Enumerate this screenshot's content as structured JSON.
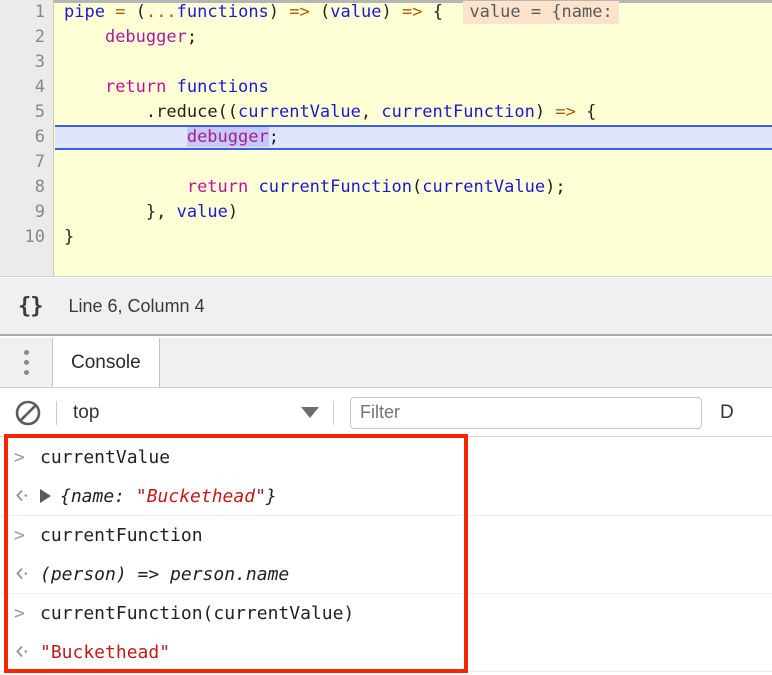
{
  "editor": {
    "language_icon": "curly-braces-icon",
    "line_numbers": [
      1,
      2,
      3,
      4,
      5,
      6,
      7,
      8,
      9,
      10
    ],
    "active_line": 6,
    "inline_hint": "value = {name:",
    "lines": [
      {
        "n": 1,
        "tokens": [
          {
            "t": "pipe",
            "c": "id"
          },
          {
            "t": " ",
            "c": "plain"
          },
          {
            "t": "=",
            "c": "op"
          },
          {
            "t": " ",
            "c": "plain"
          },
          {
            "t": "(",
            "c": "pn"
          },
          {
            "t": "...",
            "c": "op"
          },
          {
            "t": "functions",
            "c": "id"
          },
          {
            "t": ")",
            "c": "pn"
          },
          {
            "t": " ",
            "c": "plain"
          },
          {
            "t": "=>",
            "c": "op"
          },
          {
            "t": " ",
            "c": "plain"
          },
          {
            "t": "(",
            "c": "pn"
          },
          {
            "t": "value",
            "c": "id"
          },
          {
            "t": ")",
            "c": "pn"
          },
          {
            "t": " ",
            "c": "plain"
          },
          {
            "t": "=>",
            "c": "op"
          },
          {
            "t": " ",
            "c": "plain"
          },
          {
            "t": "{",
            "c": "pn"
          }
        ]
      },
      {
        "n": 2,
        "tokens": [
          {
            "t": "    ",
            "c": "plain"
          },
          {
            "t": "debugger",
            "c": "kw"
          },
          {
            "t": ";",
            "c": "pn"
          }
        ]
      },
      {
        "n": 3,
        "tokens": []
      },
      {
        "n": 4,
        "tokens": [
          {
            "t": "    ",
            "c": "plain"
          },
          {
            "t": "return",
            "c": "ret"
          },
          {
            "t": " ",
            "c": "plain"
          },
          {
            "t": "functions",
            "c": "id"
          }
        ]
      },
      {
        "n": 5,
        "tokens": [
          {
            "t": "        ",
            "c": "plain"
          },
          {
            "t": ".",
            "c": "pn"
          },
          {
            "t": "reduce",
            "c": "plain"
          },
          {
            "t": "((",
            "c": "pn"
          },
          {
            "t": "currentValue",
            "c": "id"
          },
          {
            "t": ", ",
            "c": "pn"
          },
          {
            "t": "currentFunction",
            "c": "id"
          },
          {
            "t": ")",
            "c": "pn"
          },
          {
            "t": " ",
            "c": "plain"
          },
          {
            "t": "=>",
            "c": "op"
          },
          {
            "t": " ",
            "c": "plain"
          },
          {
            "t": "{",
            "c": "pn"
          }
        ]
      },
      {
        "n": 6,
        "tokens": [
          {
            "t": "            ",
            "c": "plain"
          },
          {
            "t": "debugger",
            "c": "kw",
            "hl": true
          },
          {
            "t": ";",
            "c": "pn"
          }
        ]
      },
      {
        "n": 7,
        "tokens": []
      },
      {
        "n": 8,
        "tokens": [
          {
            "t": "            ",
            "c": "plain"
          },
          {
            "t": "return",
            "c": "ret"
          },
          {
            "t": " ",
            "c": "plain"
          },
          {
            "t": "currentFunction",
            "c": "id"
          },
          {
            "t": "(",
            "c": "pn"
          },
          {
            "t": "currentValue",
            "c": "id"
          },
          {
            "t": ")",
            "c": "pn"
          },
          {
            "t": ";",
            "c": "pn"
          }
        ]
      },
      {
        "n": 9,
        "tokens": [
          {
            "t": "        ",
            "c": "plain"
          },
          {
            "t": "}",
            "c": "pn"
          },
          {
            "t": ", ",
            "c": "pn"
          },
          {
            "t": "value",
            "c": "id"
          },
          {
            "t": ")",
            "c": "pn"
          }
        ]
      },
      {
        "n": 10,
        "tokens": [
          {
            "t": "}",
            "c": "pn"
          }
        ]
      }
    ]
  },
  "statusbar": {
    "pretty_print_icon": "{}",
    "cursor_position": "Line 6, Column 4"
  },
  "drawer": {
    "menu_icon": "kebab-menu-icon",
    "tabs": [
      {
        "label": "Console",
        "active": true
      }
    ]
  },
  "console_toolbar": {
    "clear_icon": "clear-console-icon",
    "context": "top",
    "filter_placeholder": "Filter",
    "levels_label": "D"
  },
  "console_messages": [
    {
      "kind": "input",
      "glyph": "prompt-chevron-icon",
      "text": "currentValue"
    },
    {
      "kind": "output",
      "glyph": "result-chevron-icon",
      "expandable": true,
      "italic": true,
      "parts": [
        {
          "t": "{name: ",
          "c": "plain"
        },
        {
          "t": "\"Buckethead\"",
          "c": "str"
        },
        {
          "t": "}",
          "c": "plain"
        }
      ]
    },
    {
      "kind": "input",
      "glyph": "prompt-chevron-icon",
      "text": "currentFunction"
    },
    {
      "kind": "output",
      "glyph": "result-chevron-icon",
      "expandable": false,
      "italic": true,
      "parts": [
        {
          "t": "(person) => person.name",
          "c": "plain"
        }
      ]
    },
    {
      "kind": "input",
      "glyph": "prompt-chevron-icon",
      "text": "currentFunction(currentValue)"
    },
    {
      "kind": "output",
      "glyph": "result-chevron-icon",
      "expandable": false,
      "italic": false,
      "parts": [
        {
          "t": "\"Buckethead\"",
          "c": "str"
        }
      ]
    }
  ],
  "annotation": {
    "type": "red-highlight-box",
    "color": "#f92500"
  }
}
